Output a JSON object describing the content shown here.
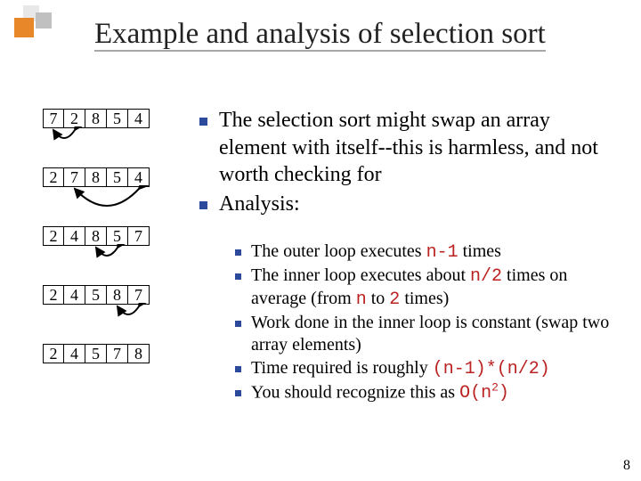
{
  "title": "Example and analysis of selection sort",
  "page_number": "8",
  "arrays": [
    {
      "vals": [
        "7",
        "2",
        "8",
        "5",
        "4"
      ],
      "swap": [
        0,
        1
      ]
    },
    {
      "vals": [
        "2",
        "7",
        "8",
        "5",
        "4"
      ],
      "swap": [
        1,
        4
      ]
    },
    {
      "vals": [
        "2",
        "4",
        "8",
        "5",
        "7"
      ],
      "swap": [
        2,
        3
      ]
    },
    {
      "vals": [
        "2",
        "4",
        "5",
        "8",
        "7"
      ],
      "swap": [
        3,
        4
      ]
    },
    {
      "vals": [
        "2",
        "4",
        "5",
        "7",
        "8"
      ],
      "swap": null
    }
  ],
  "bullets_main": [
    "The selection sort might swap an array element with itself--this is harmless, and not worth checking for",
    "Analysis:"
  ],
  "bullets_sub": [
    {
      "pre": "The outer loop executes ",
      "m": "n-1",
      "post": " times"
    },
    {
      "pre": "The inner loop executes about ",
      "m": "n/2",
      "post": " times on average (from ",
      "m2": "n",
      "post2": " to ",
      "m3": "2",
      "post3": " times)"
    },
    {
      "pre": "Work done in the inner loop is constant (swap two array elements)",
      "m": "",
      "post": ""
    },
    {
      "pre": "Time required is roughly ",
      "m": "(n-1)*(n/2)",
      "post": ""
    },
    {
      "pre": "You should recognize this as ",
      "m": "O(n",
      "sup": "2",
      "mend": ")",
      "post": ""
    }
  ]
}
